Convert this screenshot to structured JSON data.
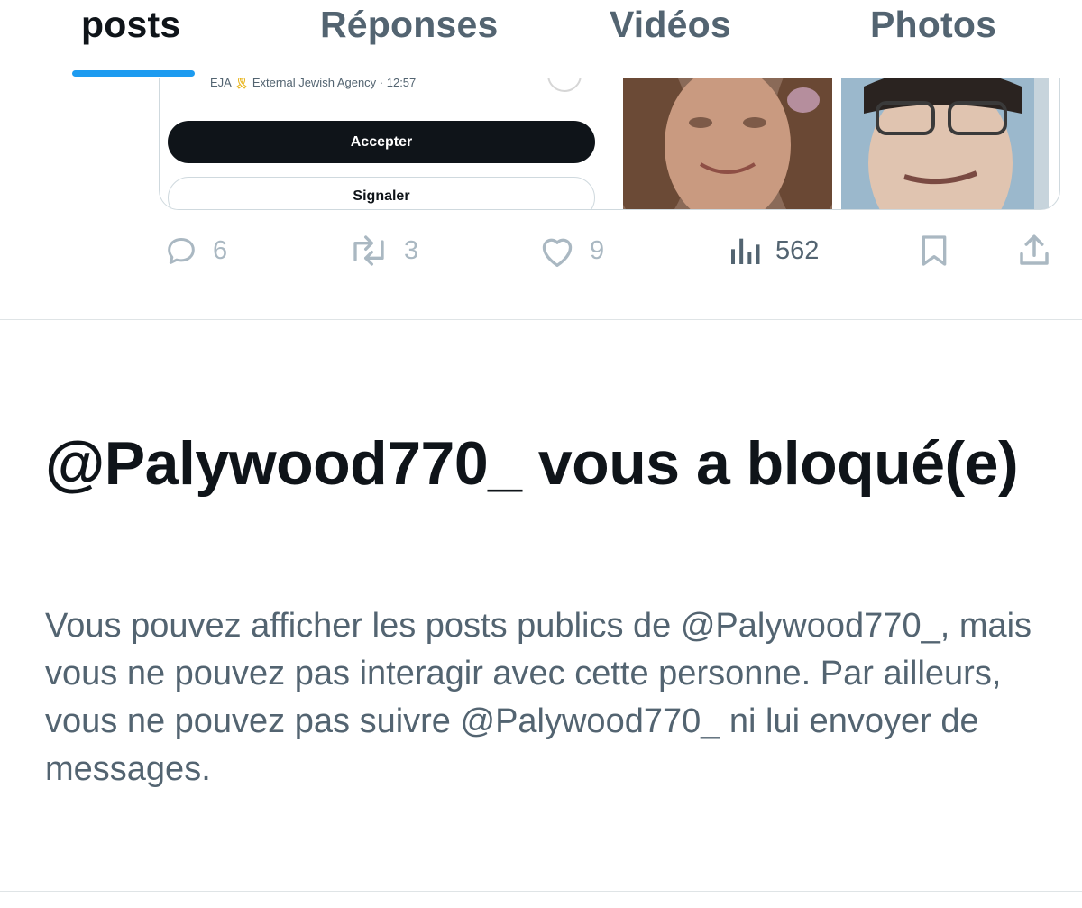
{
  "tabs": [
    {
      "label": "posts",
      "active": true
    },
    {
      "label": "Réponses",
      "active": false
    },
    {
      "label": "Vidéos",
      "active": false
    },
    {
      "label": "Photos",
      "active": false
    }
  ],
  "media": {
    "screenshot": {
      "meta_prefix": "EJA",
      "meta_emoji": "🎗",
      "meta_rest": "External Jewish Agency · 12:57",
      "accept_label": "Accepter",
      "report_label": "Signaler"
    }
  },
  "actions": {
    "replies": "6",
    "reposts": "3",
    "likes": "9",
    "views": "562"
  },
  "blocked": {
    "title": "@Palywood770_ vous a bloqué(e)",
    "body": "Vous pouvez afficher les posts publics de @Palywood770_, mais vous ne pouvez pas interagir avec cette personne. Par ailleurs, vous ne pouvez pas suivre @Palywood770_ ni lui envoyer de messages."
  },
  "colors": {
    "accent": "#1d9bf0",
    "text_primary": "#0f1419",
    "text_secondary": "#536471",
    "icon_muted": "#aab8c2"
  }
}
